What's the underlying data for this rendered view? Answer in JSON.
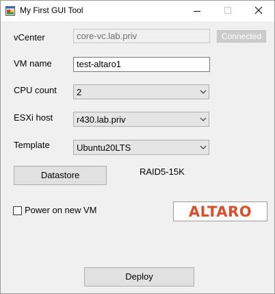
{
  "window": {
    "title": "My First GUI Tool"
  },
  "form": {
    "vcenter": {
      "label": "vCenter",
      "value": "core-vc.lab.priv",
      "button": "Connected"
    },
    "vm_name": {
      "label": "VM name",
      "value": "test-altaro1"
    },
    "cpu_count": {
      "label": "CPU count",
      "selected": "2"
    },
    "esxi_host": {
      "label": "ESXi host",
      "selected": "r430.lab.priv"
    },
    "template": {
      "label": "Template",
      "selected": "Ubuntu20LTS"
    },
    "datastore": {
      "button": "Datastore",
      "value": "RAID5-15K"
    },
    "power_on": {
      "label": "Power on new VM",
      "checked": false
    },
    "deploy_button": "Deploy"
  },
  "logo": {
    "text": "ALTARO",
    "color": "#e04e27"
  },
  "icons": {
    "app": "app-icon",
    "minimize": "minimize-icon",
    "maximize": "maximize-icon",
    "close": "close-icon",
    "dropdown": "chevron-down-icon"
  }
}
